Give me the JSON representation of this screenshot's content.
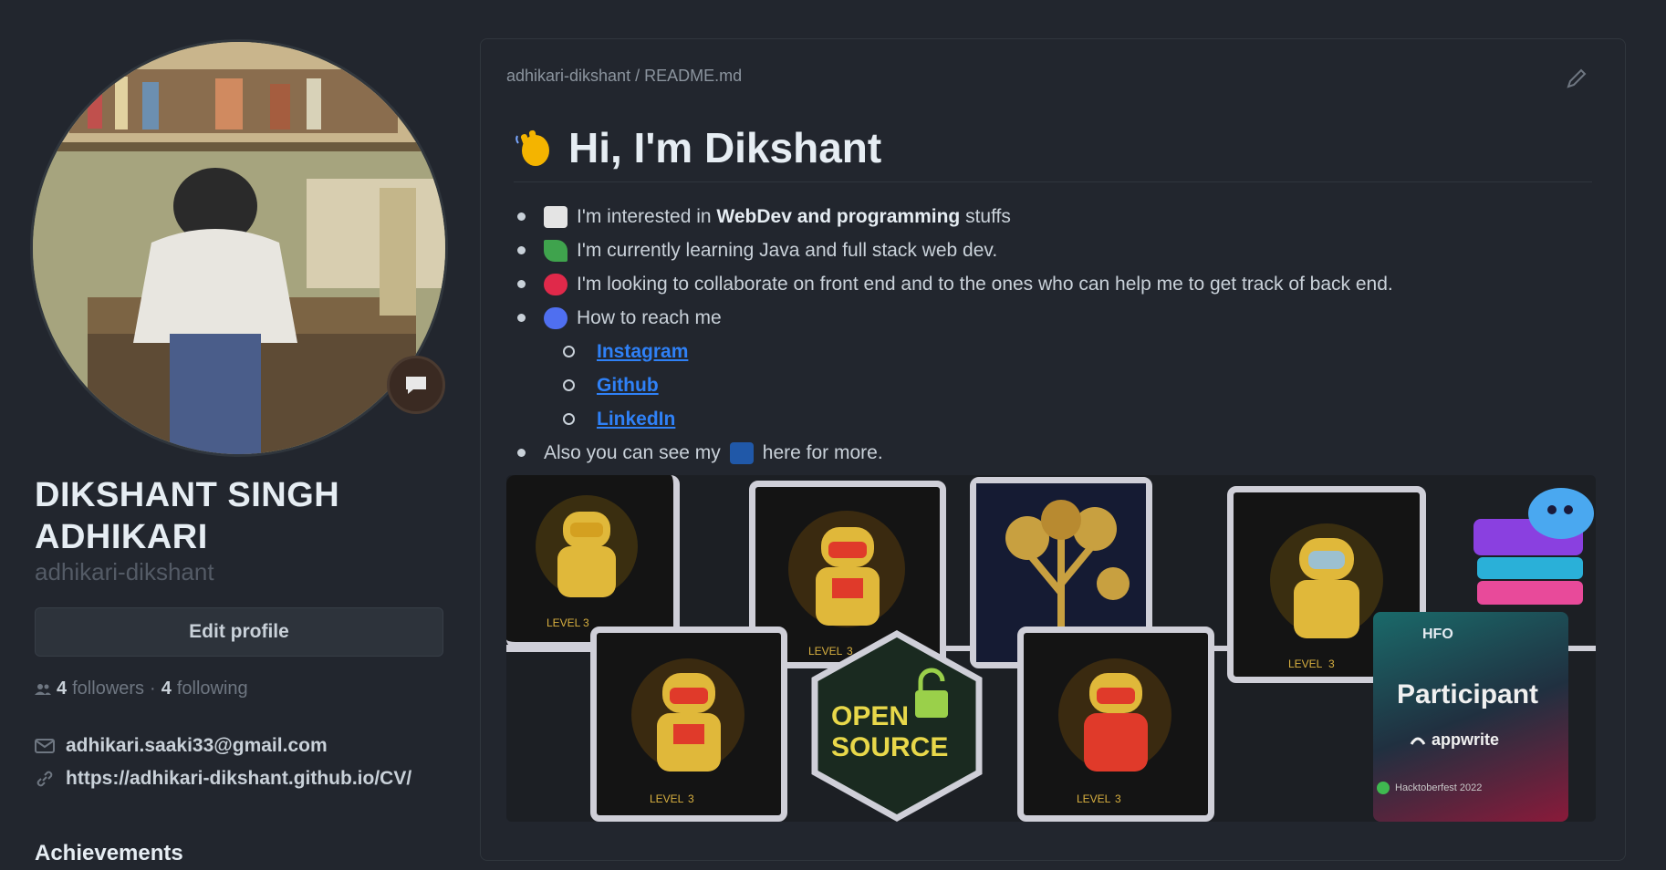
{
  "profile": {
    "name": "DIKSHANT SINGH ADHIKARI",
    "login": "adhikari-dikshant",
    "edit_label": "Edit profile",
    "followers_count": "4",
    "followers_label": "followers",
    "following_count": "4",
    "following_label": "following",
    "email": "adhikari.saaki33@gmail.com",
    "website": "https://adhikari-dikshant.github.io/CV/"
  },
  "achievements": {
    "heading": "Achievements"
  },
  "readme": {
    "path": "adhikari-dikshant / README.md",
    "heading": "Hi, I'm Dikshant",
    "items": [
      {
        "pre": "I'm interested in ",
        "bold": "WebDev and programming",
        "post": " stuffs"
      },
      {
        "text": "I'm currently learning Java and full stack web dev."
      },
      {
        "text": "I'm looking to collaborate on front end and to the ones who can help me to get track of back end."
      },
      {
        "text": "How to reach me"
      }
    ],
    "links": [
      "Instagram",
      "Github",
      "LinkedIn"
    ],
    "more": {
      "pre": "Also you can see my",
      "post": "here for more."
    }
  },
  "badges": {
    "level_label": "LEVEL",
    "level_values": [
      "3",
      "3",
      "3",
      "3",
      "3"
    ],
    "open_source_line1": "OPEN",
    "open_source_line2": "SOURCE",
    "participant": "Participant",
    "sponsor": "appwrite",
    "footer": "Hacktoberfest 2022",
    "tag_top": "HFO"
  },
  "colors": {
    "background": "#22262e",
    "accent_link": "#2f81f7",
    "badge_frame": "#cfcfd8"
  }
}
